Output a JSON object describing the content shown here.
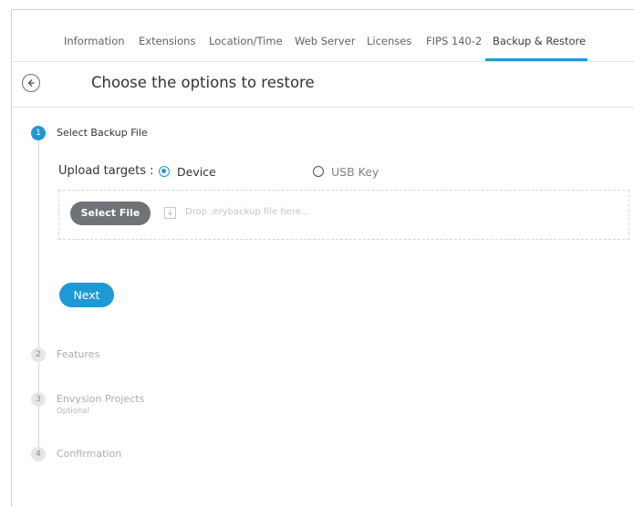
{
  "tabs": [
    {
      "label": "Information",
      "active": false
    },
    {
      "label": "Extensions",
      "active": false
    },
    {
      "label": "Location/Time",
      "active": false
    },
    {
      "label": "Web Server",
      "active": false
    },
    {
      "label": "Licenses",
      "active": false
    },
    {
      "label": "FIPS 140-2",
      "active": false
    },
    {
      "label": "Backup & Restore",
      "active": true
    }
  ],
  "header": {
    "back_icon": "arrow-left-circle-icon",
    "title": "Choose the options to restore"
  },
  "steps": [
    {
      "number": "1",
      "label": "Select Backup File",
      "sublabel": "",
      "state": "active"
    },
    {
      "number": "2",
      "label": "Features",
      "sublabel": "",
      "state": "inactive"
    },
    {
      "number": "3",
      "label": "Envysion Projects",
      "sublabel": "Optional",
      "state": "inactive"
    },
    {
      "number": "4",
      "label": "Confirmation",
      "sublabel": "",
      "state": "inactive"
    }
  ],
  "upload": {
    "label": "Upload targets :",
    "options": [
      {
        "label": "Device",
        "checked": true
      },
      {
        "label": "USB Key",
        "checked": false
      }
    ]
  },
  "dropzone": {
    "select_label": "Select File",
    "drop_icon": "download-icon",
    "placeholder": "Drop .erybackup file here..."
  },
  "actions": {
    "next_label": "Next"
  },
  "colors": {
    "accent": "#1d9ad6",
    "select_button": "#6e7377"
  }
}
